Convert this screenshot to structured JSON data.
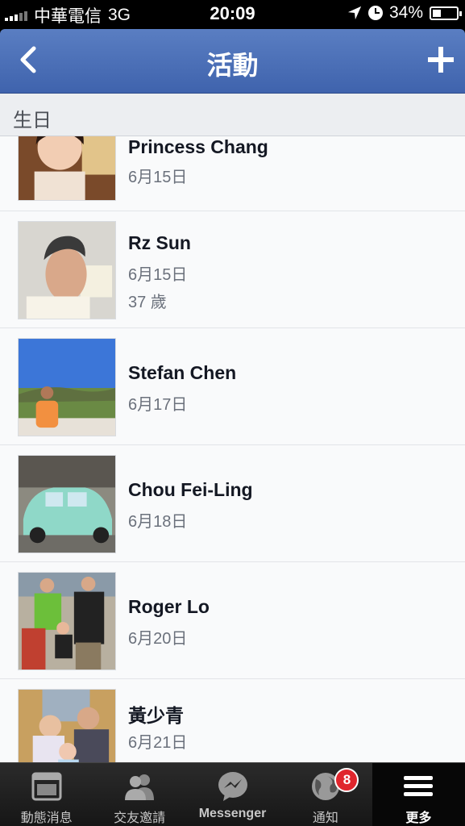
{
  "status_bar": {
    "carrier": "中華電信",
    "network": "3G",
    "time": "20:09",
    "battery": "34%",
    "battery_level": 0.34,
    "signal_bars": 3,
    "icons": [
      "signal-icon",
      "location-arrow-icon",
      "clock-icon",
      "battery-icon"
    ]
  },
  "nav": {
    "title": "活動",
    "back_icon": "chevron-left-icon",
    "add_icon": "plus-icon"
  },
  "section": {
    "header": "生日"
  },
  "birthdays": [
    {
      "name": "Princess Chang",
      "date": "6月15日",
      "age": ""
    },
    {
      "name": "Rz Sun",
      "date": "6月15日",
      "age": "37 歲"
    },
    {
      "name": "Stefan Chen",
      "date": "6月17日",
      "age": ""
    },
    {
      "name": "Chou Fei-Ling",
      "date": "6月18日",
      "age": ""
    },
    {
      "name": "Roger Lo",
      "date": "6月20日",
      "age": ""
    },
    {
      "name": "黃少青",
      "date": "6月21日",
      "age": ""
    }
  ],
  "tabbar": {
    "tabs": [
      {
        "label": "動態消息",
        "icon": "news-feed-icon"
      },
      {
        "label": "交友邀請",
        "icon": "friend-requests-icon"
      },
      {
        "label": "Messenger",
        "icon": "messenger-icon"
      },
      {
        "label": "通知",
        "icon": "notifications-globe-icon",
        "badge": "8"
      },
      {
        "label": "更多",
        "icon": "menu-icon",
        "active": true
      }
    ]
  },
  "colors": {
    "nav_blue": "#3f63ad",
    "badge_red": "#e0262d",
    "list_bg": "#f9fafb",
    "name_text": "#141823",
    "meta_text": "#6b717c"
  }
}
